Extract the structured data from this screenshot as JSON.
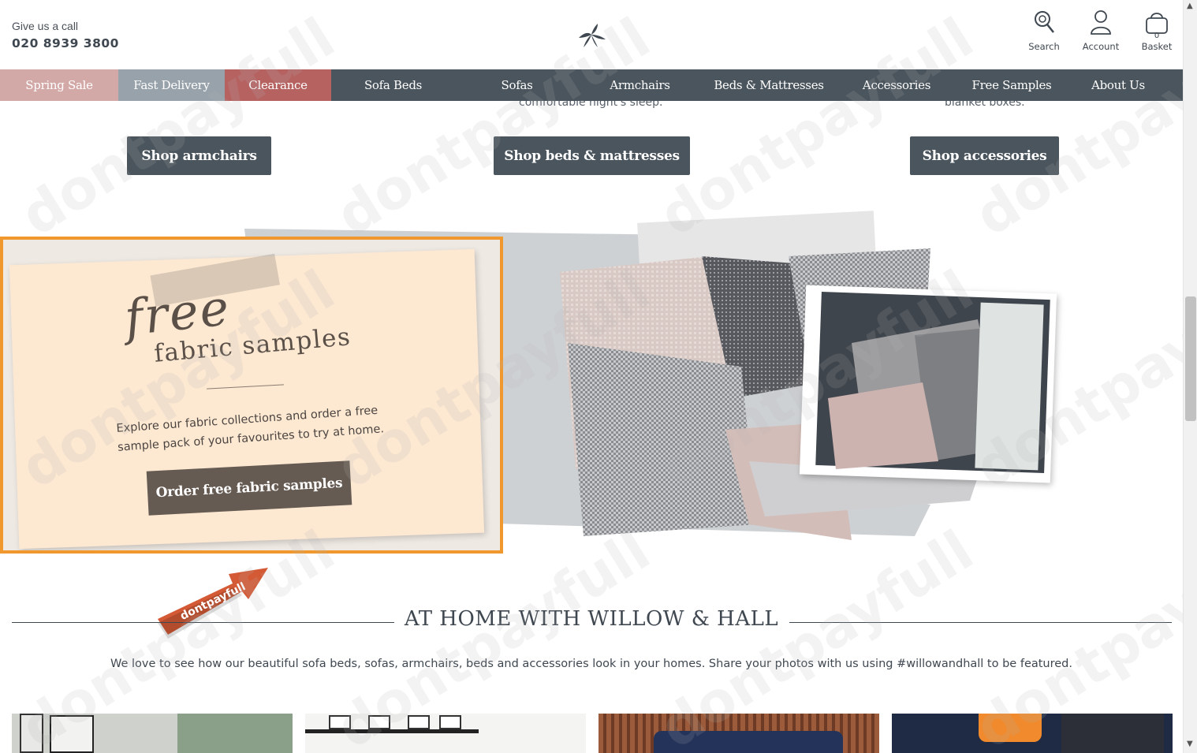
{
  "header": {
    "call_label": "Give us a call",
    "phone": "020 8939 3800",
    "icons": [
      {
        "name": "search-icon",
        "label": "Search"
      },
      {
        "name": "account-icon",
        "label": "Account"
      },
      {
        "name": "basket-icon",
        "label": "Basket",
        "count": "0"
      }
    ]
  },
  "nav": {
    "items": [
      {
        "label": "Spring Sale"
      },
      {
        "label": "Fast Delivery"
      },
      {
        "label": "Clearance"
      },
      {
        "label": "Sofa Beds"
      },
      {
        "label": "Sofas"
      },
      {
        "label": "Armchairs"
      },
      {
        "label": "Beds & Mattresses"
      },
      {
        "label": "Accessories"
      },
      {
        "label": "Free Samples"
      },
      {
        "label": "About Us"
      }
    ]
  },
  "categories": {
    "fragment_mid": "comfortable night's sleep.",
    "fragment_right": "blanket boxes.",
    "buttons": [
      "Shop armchairs",
      "Shop beds & mattresses",
      "Shop accessories"
    ]
  },
  "promo": {
    "script_word": "free",
    "title": "fabric samples",
    "description": "Explore our fabric collections and order a free sample pack of your favourites to try at home.",
    "button": "Order free fabric samples"
  },
  "badge": {
    "text": "dontpayfull"
  },
  "home": {
    "title": "AT HOME WITH WILLOW & HALL",
    "description": "We love to see how our beautiful sofa beds, sofas, armchairs, beds and accessories look in your homes. Share your photos with us using #willowandhall to be featured."
  },
  "watermark": "dontpayfull",
  "colors": {
    "nav_bg": "#4b555d",
    "sale": "#d3a9a7",
    "fast_delivery": "#98a2aa",
    "clearance": "#b66261",
    "promo_border": "#f0982e",
    "promo_button": "#665b52"
  }
}
